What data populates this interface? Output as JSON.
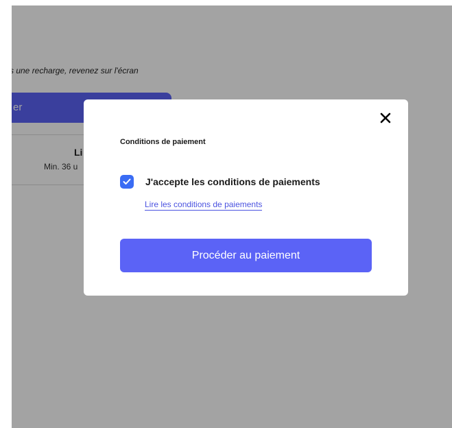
{
  "background": {
    "note": "s une recharge, revenez sur l'écran",
    "button_label": "er",
    "card": {
      "title": "Li",
      "subtitle": "Min. 36 u"
    }
  },
  "modal": {
    "title": "Conditions de paiement",
    "close_icon": "close-icon",
    "checkbox": {
      "checked": true,
      "label": "J'accepte les conditions de paiements"
    },
    "terms_link": "Lire les conditions de paiements",
    "primary_button": "Procéder au paiement"
  },
  "colors": {
    "accent": "#5b63f6",
    "checkbox": "#3a6cf4",
    "link": "#4a52e0",
    "overlay": "rgba(0,0,0,0.36)"
  }
}
